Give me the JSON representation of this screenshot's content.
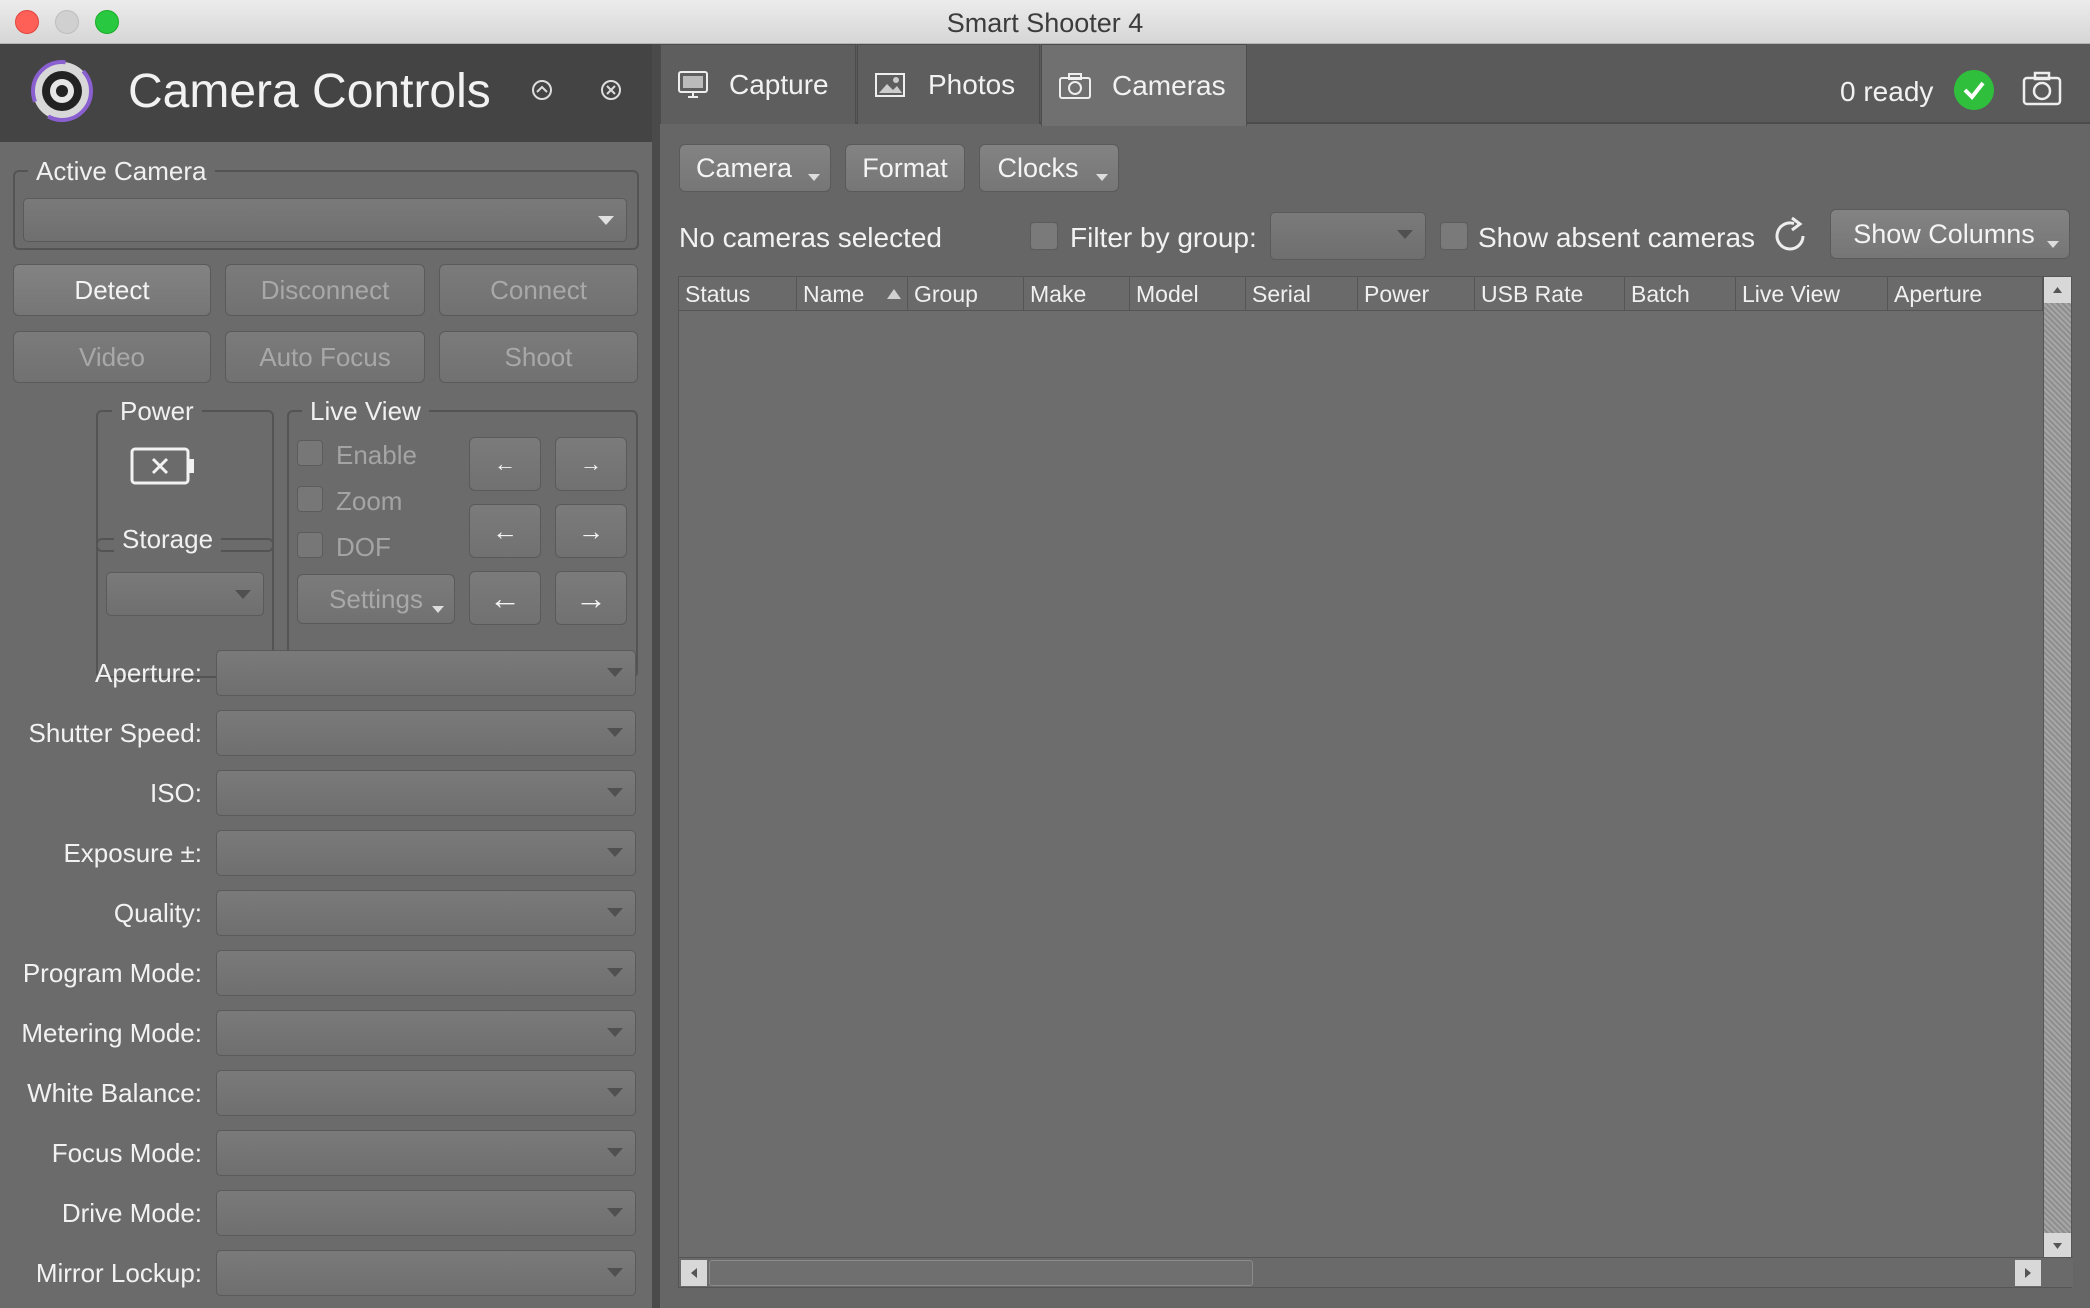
{
  "window": {
    "title": "Smart Shooter 4"
  },
  "left": {
    "title": "Camera Controls",
    "active_camera_label": "Active Camera",
    "buttons": {
      "detect": "Detect",
      "disconnect": "Disconnect",
      "connect": "Connect",
      "video": "Video",
      "auto_focus": "Auto Focus",
      "shoot": "Shoot"
    },
    "power_label": "Power",
    "storage_label": "Storage",
    "live_view": {
      "label": "Live View",
      "enable": "Enable",
      "zoom": "Zoom",
      "dof": "DOF",
      "settings": "Settings",
      "arrow_left": "←",
      "arrow_right": "→"
    },
    "fields": [
      "Aperture:",
      "Shutter Speed:",
      "ISO:",
      "Exposure ±:",
      "Quality:",
      "Program Mode:",
      "Metering Mode:",
      "White Balance:",
      "Focus Mode:",
      "Drive Mode:",
      "Mirror Lockup:"
    ]
  },
  "tabs": [
    {
      "label": "Capture"
    },
    {
      "label": "Photos"
    },
    {
      "label": "Cameras"
    }
  ],
  "status": {
    "ready": "0 ready"
  },
  "toolbar": {
    "camera": "Camera",
    "format": "Format",
    "clocks": "Clocks",
    "selection": "No cameras selected",
    "filter_by_group": "Filter by group:",
    "show_absent": "Show absent cameras",
    "show_columns": "Show Columns"
  },
  "table": {
    "columns": [
      "Status",
      "Name",
      "Group",
      "Make",
      "Model",
      "Serial",
      "Power",
      "USB Rate",
      "Batch",
      "Live View",
      "Aperture"
    ],
    "rows": []
  },
  "colors": {
    "ready_green": "#2fbf3d",
    "close_red": "#fe5f57",
    "zoom_green": "#28c940"
  }
}
